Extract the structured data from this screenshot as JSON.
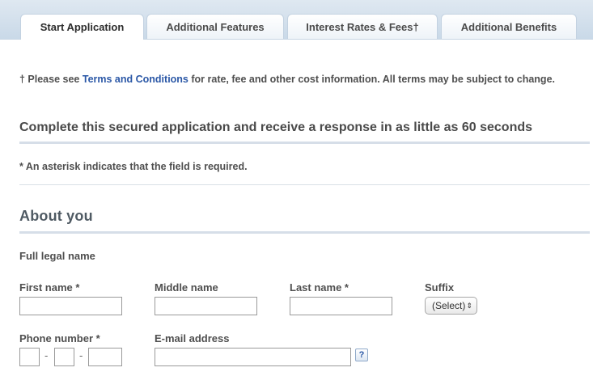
{
  "tabs": [
    {
      "label": "Start Application"
    },
    {
      "label": "Additional Features"
    },
    {
      "label": "Interest Rates & Fees†"
    },
    {
      "label": "Additional Benefits"
    }
  ],
  "note": {
    "prefix": "† Please see ",
    "link": "Terms and Conditions",
    "suffix": " for rate, fee and other cost information. All terms may be subject to change."
  },
  "headline": "Complete this secured application and receive a response in as little as 60 seconds",
  "required_note": "* An asterisk indicates that the field is required.",
  "section_title": "About you",
  "form": {
    "full_legal_name": "Full legal name",
    "first_name": {
      "label": "First name *",
      "value": ""
    },
    "middle_name": {
      "label": "Middle name",
      "value": ""
    },
    "last_name": {
      "label": "Last name *",
      "value": ""
    },
    "suffix": {
      "label": "Suffix",
      "selected": "(Select)"
    },
    "phone": {
      "label": "Phone number *",
      "area": "",
      "prefix": "",
      "line": "",
      "separator": "-"
    },
    "email": {
      "label": "E-mail address",
      "value": "",
      "help": "?"
    }
  },
  "colors": {
    "link": "#2a57a6",
    "tab_bar": "#c9d9e8"
  }
}
